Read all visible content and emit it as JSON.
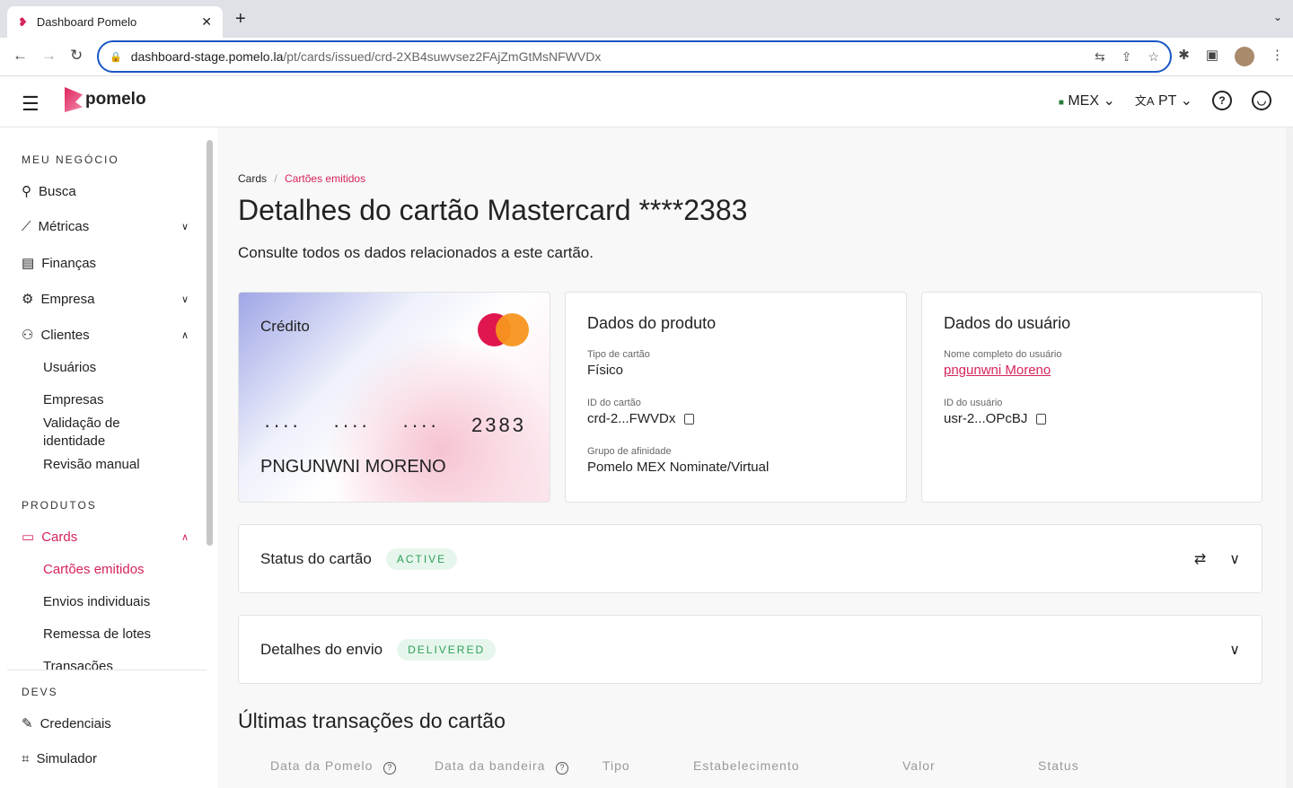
{
  "browser": {
    "tab_title": "Dashboard Pomelo",
    "url_host": "dashboard-stage.pomelo.la",
    "url_path": "/pt/cards/issued/crd-2XB4suwvsez2FAjZmGtMsNFWVDx"
  },
  "header": {
    "logo": "pomelo",
    "country": "MEX",
    "language": "PT"
  },
  "sidebar": {
    "sec1": "MEU NEGÓCIO",
    "items": [
      {
        "label": "Busca"
      },
      {
        "label": "Métricas"
      },
      {
        "label": "Finanças"
      },
      {
        "label": "Empresa"
      },
      {
        "label": "Clientes"
      }
    ],
    "clientes_sub": [
      "Usuários",
      "Empresas",
      "Validação de identidade",
      "Revisão manual"
    ],
    "sec2": "PRODUTOS",
    "cards": "Cards",
    "cards_sub": [
      "Cartões emitidos",
      "Envios individuais",
      "Remessa de lotes",
      "Transações"
    ],
    "sec3": "DEVS",
    "devs": [
      "Credenciais",
      "Simulador"
    ]
  },
  "main": {
    "breadcrumb": [
      "Cards",
      "Cartões emitidos"
    ],
    "title": "Detalhes do cartão Mastercard ****2383",
    "subtitle": "Consulte todos os dados relacionados a este cartão.",
    "card": {
      "type": "Crédito",
      "masked": [
        "····",
        "····",
        "····"
      ],
      "last4": "2383",
      "holder": "PNGUNWNI MORENO"
    },
    "product": {
      "title": "Dados do produto",
      "type_label": "Tipo de cartão",
      "type": "Físico",
      "id_label": "ID do cartão",
      "id": "crd-2...FWVDx",
      "group_label": "Grupo de afinidade",
      "group": "Pomelo MEX Nominate/Virtual"
    },
    "user": {
      "title": "Dados do usuário",
      "name_label": "Nome completo do usuário",
      "name": "pngunwni Moreno",
      "id_label": "ID do usuário",
      "id": "usr-2...OPcBJ"
    },
    "status": {
      "title": "Status do cartão",
      "badge": "ACTIVE"
    },
    "shipping": {
      "title": "Detalhes do envio",
      "badge": "DELIVERED"
    },
    "transactions": {
      "title": "Últimas transações do cartão",
      "columns": [
        "Data da Pomelo",
        "Data da bandeira",
        "Tipo",
        "Estabelecimento",
        "Valor",
        "Status"
      ]
    }
  }
}
